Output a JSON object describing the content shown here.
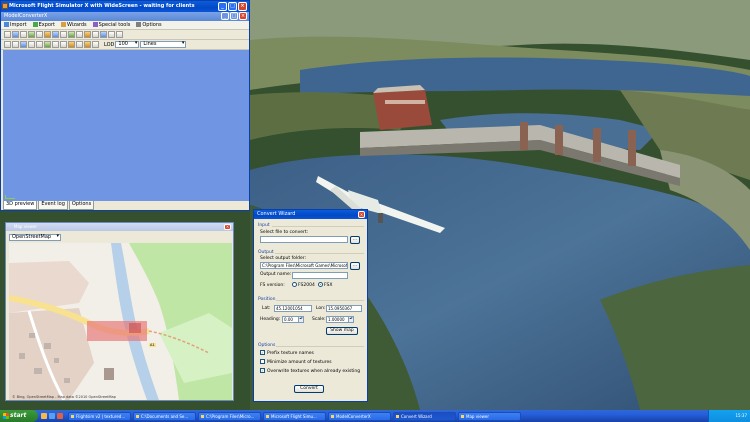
{
  "main_window": {
    "title": "Microsoft Flight Simulator X with WideScreen - waiting for clients",
    "menu": [
      "Import",
      "Export",
      "Wizards",
      "Special tools",
      "Options"
    ],
    "document_title": "ModelConverterX",
    "lod_label": "LOD",
    "lod_value": "100",
    "view_value": "Lines",
    "tabs": [
      "3D preview",
      "Event log",
      "Options"
    ]
  },
  "map_viewer": {
    "title": "Map viewer",
    "map_source": "OpenStreetMap",
    "attribution": "© Bing, OpenStreetMap - Map data ©2010 OpenStreetMap",
    "road_label": "A1"
  },
  "convert_wizard": {
    "title": "Convert Wizard",
    "input_group": "Input",
    "select_file_label": "Select file to convert:",
    "file_value": "",
    "browse_label": "...",
    "output_group": "Output",
    "select_folder_label": "Select output folder:",
    "folder_value": "C:\\Program Files\\Microsoft Games\\Microsoft",
    "output_name_label": "Output name:",
    "output_name_value": "",
    "fs_version_label": "FS version:",
    "fs_options": [
      "FS2004",
      "FSX"
    ],
    "fs_selected": "FSX",
    "position_group": "Position",
    "lat_label": "Lat:",
    "lat_value": "45.12001054",
    "lon_label": "Lon:",
    "lon_value": "15.0950367",
    "heading_label": "Heading:",
    "heading_value": "0.00",
    "scale_label": "Scale:",
    "scale_value": "1.00000",
    "show_map_label": "Show map",
    "options_group": "Options",
    "options": [
      {
        "label": "Prefix texture names",
        "checked": true
      },
      {
        "label": "Minimize amount of textures",
        "checked": false
      },
      {
        "label": "Overwrite textures when already existing",
        "checked": true
      }
    ],
    "convert_label": "Convert"
  },
  "taskbar": {
    "start_label": "start",
    "tasks": [
      "Flightsim v2 | textured...",
      "C:\\Documents and Se...",
      "C:\\Program Files\\Micro...",
      "Microsoft Flight Simu...",
      "ModelConverterX",
      "Convert Wizard",
      "Map viewer"
    ],
    "active_task_index": 5,
    "clock": "15:37"
  },
  "colors": {
    "xp_blue": "#0a5ddf",
    "viewport_blue": "#6f95e3",
    "dialog_face": "#ece9d8",
    "start_green": "#2f8b2f"
  }
}
